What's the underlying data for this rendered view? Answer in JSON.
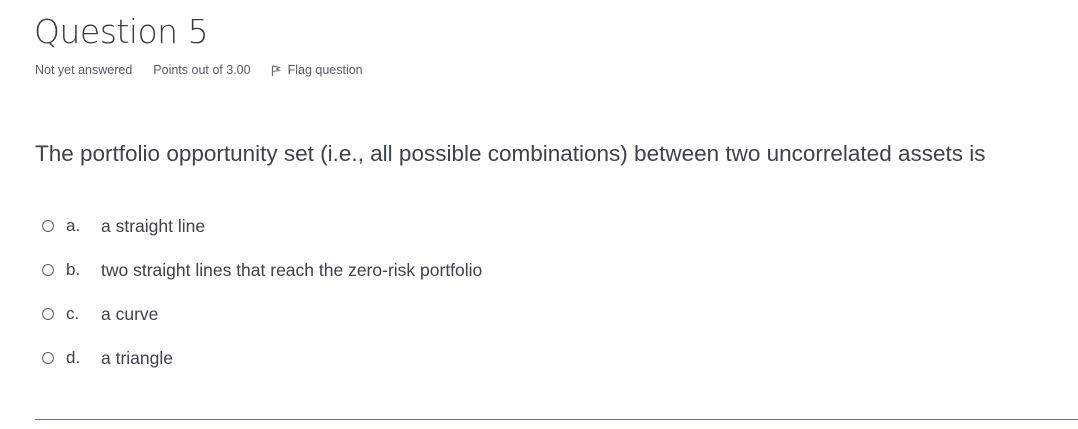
{
  "question": {
    "title": "Question 5",
    "state": "Not yet answered",
    "points": "Points out of 3.00",
    "flag_label": "Flag question",
    "text": "The portfolio opportunity set (i.e., all possible combinations) between two uncorrelated assets is"
  },
  "answers": [
    {
      "letter": "a.",
      "label": "a straight line",
      "selected": false
    },
    {
      "letter": "b.",
      "label": "two straight lines that reach the zero-risk portfolio",
      "selected": false
    },
    {
      "letter": "c.",
      "label": "a curve",
      "selected": false
    },
    {
      "letter": "d.",
      "label": "a triangle",
      "selected": false
    }
  ],
  "icons": {
    "flag": "flag-icon",
    "radio": "radio-icon"
  }
}
